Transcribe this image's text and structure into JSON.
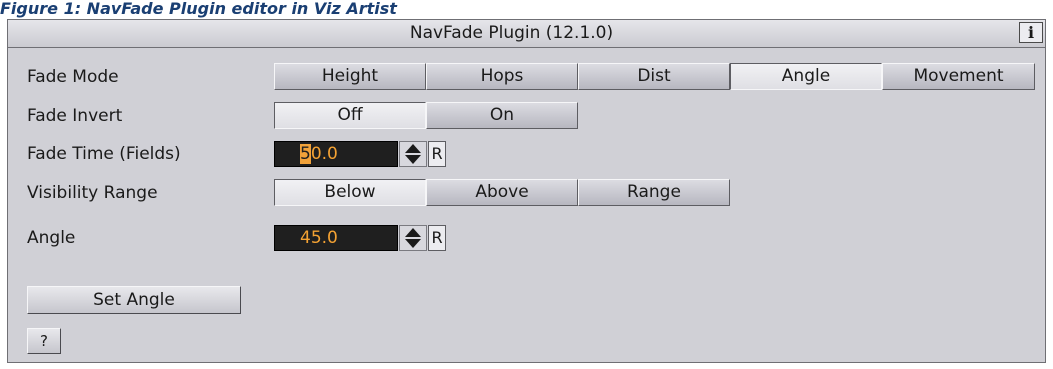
{
  "caption": "Figure 1: NavFade Plugin editor in Viz Artist",
  "panel": {
    "title": "NavFade Plugin (12.1.0)",
    "info_label": "i"
  },
  "fade_mode": {
    "label": "Fade Mode",
    "options": [
      "Height",
      "Hops",
      "Dist",
      "Angle",
      "Movement"
    ],
    "selected": "Angle"
  },
  "fade_invert": {
    "label": "Fade Invert",
    "options": [
      "Off",
      "On"
    ],
    "selected": "Off"
  },
  "fade_time": {
    "label": "Fade Time (Fields)",
    "value_selected_part": "5",
    "value_rest": "0.0",
    "reset_label": "R"
  },
  "visibility_range": {
    "label": "Visibility Range",
    "options": [
      "Below",
      "Above",
      "Range"
    ],
    "selected": "Below"
  },
  "angle": {
    "label": "Angle",
    "value": "45.0",
    "reset_label": "R"
  },
  "set_angle_label": "Set Angle",
  "help_label": "?",
  "icons": {
    "info": "info-icon",
    "spinner": "spinner-arrows-icon"
  },
  "colors": {
    "panel_bg": "#d0d0d6",
    "field_bg": "#1f1f1f",
    "field_text": "#f4a233"
  }
}
